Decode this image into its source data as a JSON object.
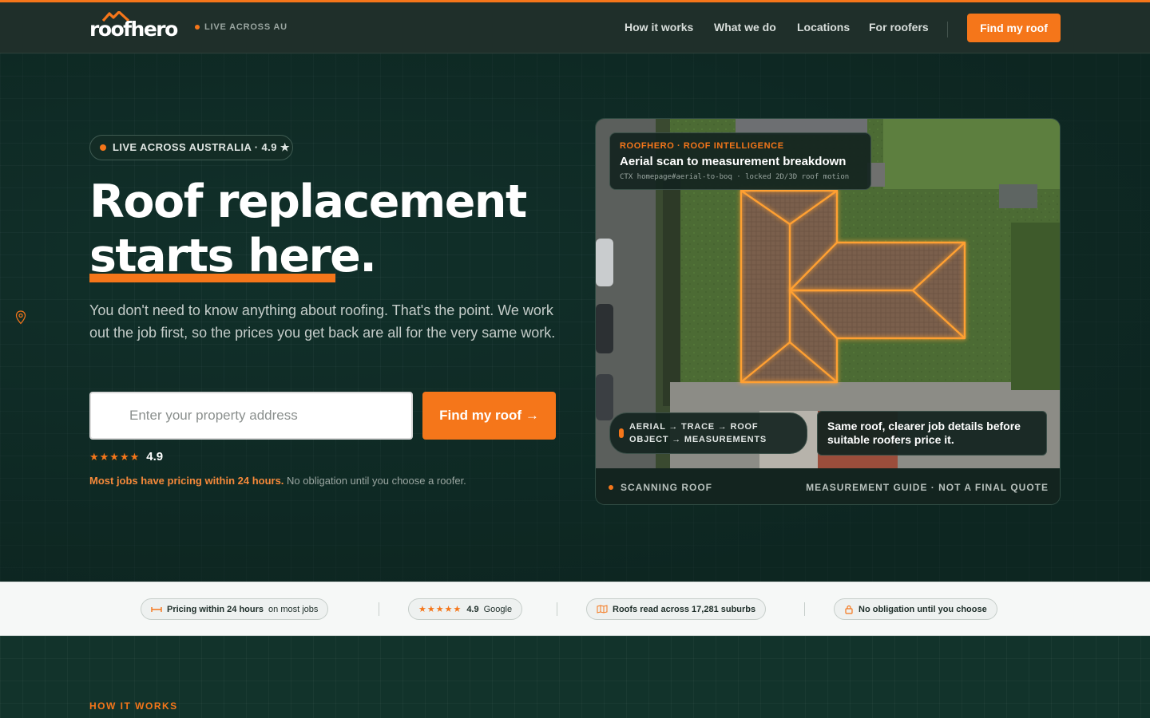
{
  "brand": {
    "logo_text": "roofhero",
    "tagline": "LIVE ACROSS AU",
    "accent": "#f5761a"
  },
  "nav": {
    "items": [
      {
        "label": "How it works"
      },
      {
        "label": "What we do"
      },
      {
        "label": "Locations"
      },
      {
        "label": "For roofers"
      }
    ],
    "cta": "Find my roof"
  },
  "hero": {
    "badge": "LIVE ACROSS AUSTRALIA · 4.9 ★",
    "headline_line1": "Roof replacement",
    "headline_line2": "starts here.",
    "subtext": "You don't need to know anything about roofing. That's the point. We work out the job first, so the prices you get back are all for the very same work.",
    "address_placeholder": "Enter your property address",
    "find_button": "Find my roof →",
    "stars": "★★★★★",
    "rating": "4.9",
    "note_highlight": "Most jobs have pricing within 24 hours.",
    "note_rest": " No obligation until you choose a roofer."
  },
  "card": {
    "kicker": "ROOFHERO · ROOF INTELLIGENCE",
    "title": "Aerial scan to measurement breakdown",
    "code": "CTX homepage#aerial-to-boq · locked 2D/3D roof motion",
    "flow_line1": "AERIAL → TRACE → ROOF",
    "flow_line2": "OBJECT → MEASUREMENTS",
    "note": "Same roof, clearer job details before suitable roofers price it.",
    "status": "SCANNING ROOF",
    "disclaimer": "MEASUREMENT GUIDE · NOT A FINAL QUOTE"
  },
  "trust": {
    "chip1_bold": "Pricing within 24 hours",
    "chip1_rest": "on most jobs",
    "chip2_stars": "★★★★★",
    "chip2_bold": "4.9",
    "chip2_rest": "Google",
    "chip3": "Roofs read across 17,281 suburbs",
    "chip4": "No obligation until you choose"
  },
  "how": {
    "label": "HOW IT WORKS"
  }
}
